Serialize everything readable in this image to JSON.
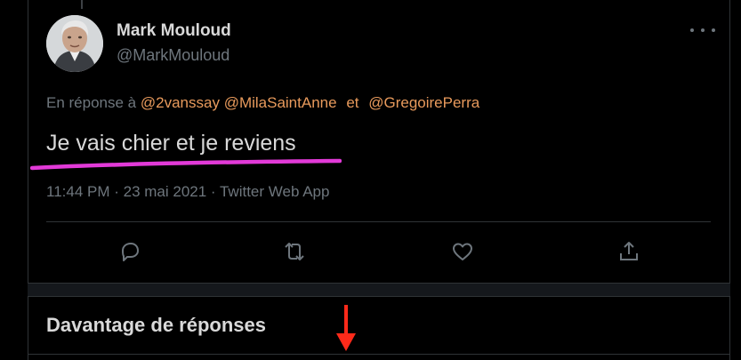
{
  "tweet": {
    "author_name": "Mark Mouloud",
    "author_handle": "@MarkMouloud",
    "reply_prefix": "En réponse à",
    "mentions": [
      "@2vanssay",
      "@MilaSaintAnne",
      "@GregoirePerra"
    ],
    "reply_connector": "et",
    "text": "Je vais chier et je reviens",
    "timestamp": "11:44 PM · 23 mai 2021 · Twitter Web App"
  },
  "actions": {
    "reply_icon": "reply-icon",
    "retweet_icon": "retweet-icon",
    "like_icon": "like-icon",
    "share_icon": "share-icon"
  },
  "section": {
    "title": "Davantage de réponses"
  },
  "colors": {
    "background": "#000000",
    "text": "#d9d9d9",
    "muted": "#6e767d",
    "mention": "#e89a5c",
    "highlight": "#e23ad8",
    "arrow": "#ff2a1a",
    "divider": "#2f3336"
  }
}
